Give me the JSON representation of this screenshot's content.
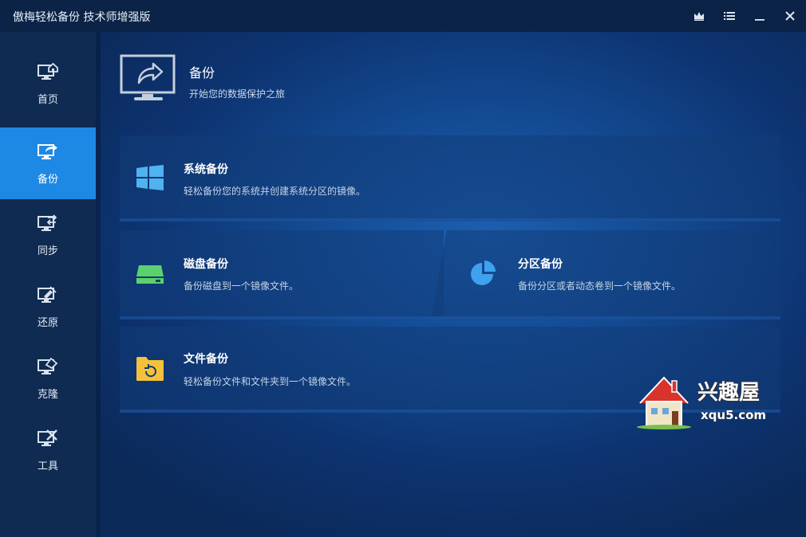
{
  "window": {
    "title": "傲梅轻松备份 技术师增强版"
  },
  "titlebar_buttons": [
    "crown-icon",
    "menu-icon",
    "minimize-icon",
    "close-icon"
  ],
  "sidebar": {
    "items": [
      {
        "label": "首页",
        "icon": "home-monitor-icon"
      },
      {
        "label": "备份",
        "icon": "backup-monitor-icon",
        "active": true
      },
      {
        "label": "同步",
        "icon": "sync-monitor-icon"
      },
      {
        "label": "还原",
        "icon": "restore-monitor-icon"
      },
      {
        "label": "克隆",
        "icon": "clone-monitor-icon"
      },
      {
        "label": "工具",
        "icon": "tools-monitor-icon"
      }
    ]
  },
  "header": {
    "title": "备份",
    "subtitle": "开始您的数据保护之旅"
  },
  "cards": {
    "system": {
      "title": "系统备份",
      "desc": "轻松备份您的系统并创建系统分区的镜像。"
    },
    "disk": {
      "title": "磁盘备份",
      "desc": "备份磁盘到一个镜像文件。"
    },
    "partition": {
      "title": "分区备份",
      "desc": "备份分区或者动态卷到一个镜像文件。"
    },
    "file": {
      "title": "文件备份",
      "desc": "轻松备份文件和文件夹到一个镜像文件。"
    }
  },
  "watermark": {
    "brand": "兴趣屋",
    "site": "xqu5.com"
  },
  "colors": {
    "accent": "#1e88e5",
    "windows_logo": "#4fb3f0",
    "disk_icon": "#5bd16e",
    "pie_icon": "#3fa2ee",
    "folder_icon": "#f6c13a"
  }
}
